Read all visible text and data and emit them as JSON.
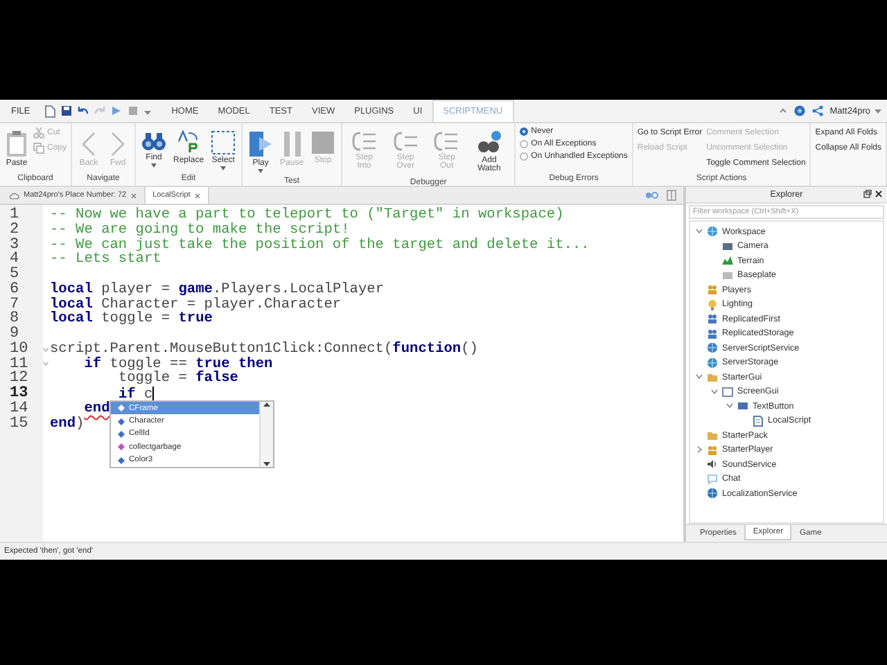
{
  "menu_bar": {
    "file": "FILE",
    "tabs": [
      {
        "label": "HOME",
        "selected": false
      },
      {
        "label": "MODEL",
        "selected": false
      },
      {
        "label": "TEST",
        "selected": false
      },
      {
        "label": "VIEW",
        "selected": false
      },
      {
        "label": "PLUGINS",
        "selected": false
      },
      {
        "label": "UI",
        "selected": false
      },
      {
        "label": "SCRIPTMENU",
        "selected": true
      }
    ],
    "user": "Matt24pro"
  },
  "ribbon": {
    "groups": [
      {
        "label": "Clipboard",
        "columns": [
          [
            {
              "kind": "large",
              "label": "Paste",
              "disabled": false
            }
          ],
          [
            {
              "kind": "small",
              "label": "Cut",
              "disabled": true
            },
            {
              "kind": "small",
              "label": "Copy",
              "disabled": true
            }
          ]
        ]
      },
      {
        "label": "Navigate",
        "columns": [
          [
            {
              "kind": "large",
              "label": "Back",
              "disabled": true
            }
          ],
          [
            {
              "kind": "large",
              "label": "Fwd",
              "disabled": true
            }
          ]
        ]
      },
      {
        "label": "Edit",
        "columns": [
          [
            {
              "kind": "large",
              "label": "Find",
              "disabled": false,
              "dropdown": true
            }
          ],
          [
            {
              "kind": "large",
              "label": "Replace",
              "disabled": false
            }
          ],
          [
            {
              "kind": "large",
              "label": "Select",
              "disabled": false,
              "dropdown": true
            }
          ]
        ]
      },
      {
        "label": "Test",
        "columns": [
          [
            {
              "kind": "large",
              "label": "Play",
              "disabled": false,
              "dropdown": true
            }
          ],
          [
            {
              "kind": "large",
              "label": "Pause",
              "disabled": true
            }
          ],
          [
            {
              "kind": "large",
              "label": "Stop",
              "disabled": true
            }
          ]
        ]
      },
      {
        "label": "Debugger",
        "columns": [
          [
            {
              "kind": "large",
              "label": "Step Into",
              "disabled": true
            }
          ],
          [
            {
              "kind": "large",
              "label": "Step Over",
              "disabled": true
            }
          ],
          [
            {
              "kind": "large",
              "label": "Step Out",
              "disabled": true
            }
          ],
          [
            {
              "kind": "large",
              "label": "Add Watch",
              "disabled": false
            }
          ]
        ]
      },
      {
        "label": "Debug Errors",
        "columns": [
          [
            {
              "kind": "radio",
              "label": "Never",
              "selected": true
            },
            {
              "kind": "radio",
              "label": "On All Exceptions",
              "selected": false
            },
            {
              "kind": "radio",
              "label": "On Unhandled Exceptions",
              "selected": false
            }
          ]
        ]
      },
      {
        "label": "Script Actions",
        "columns": [
          [
            {
              "kind": "link",
              "label": "Go to Script Error",
              "disabled": false
            },
            {
              "kind": "link",
              "label": "Reload Script",
              "disabled": true
            }
          ],
          [
            {
              "kind": "link",
              "label": "Comment Selection",
              "disabled": true
            },
            {
              "kind": "link",
              "label": "Uncomment Selection",
              "disabled": true
            },
            {
              "kind": "link",
              "label": "Toggle Comment Selection",
              "disabled": false
            }
          ]
        ]
      },
      {
        "columns": [
          [
            {
              "kind": "link",
              "label": "Expand All Folds",
              "disabled": false
            },
            {
              "kind": "link",
              "label": "Collapse All Folds",
              "disabled": false
            }
          ]
        ]
      }
    ]
  },
  "document_tabs": [
    {
      "label": "Matt24pro's Place Number: 72",
      "selected": false
    },
    {
      "label": "LocalScript",
      "selected": true
    }
  ],
  "editor": {
    "lines": [
      {
        "number": "1",
        "tokens": [
          {
            "kind": "comment",
            "text": "-- Now we have a part to teleport to (\"Target\" in workspace)"
          }
        ]
      },
      {
        "number": "2",
        "tokens": [
          {
            "kind": "comment",
            "text": "-- We are going to make the script!"
          }
        ]
      },
      {
        "number": "3",
        "tokens": [
          {
            "kind": "comment",
            "text": "-- We can just take the position of the target and delete it..."
          }
        ]
      },
      {
        "number": "4",
        "tokens": [
          {
            "kind": "comment",
            "text": "-- Lets start"
          }
        ]
      },
      {
        "number": "5"
      },
      {
        "number": "6",
        "tokens": [
          {
            "kind": "keyword",
            "text": "local"
          },
          {
            "kind": "text",
            "text": " player = "
          },
          {
            "kind": "keyword",
            "text": "game"
          },
          {
            "kind": "text",
            "text": ".Players.LocalPlayer"
          }
        ]
      },
      {
        "number": "7",
        "tokens": [
          {
            "kind": "keyword",
            "text": "local"
          },
          {
            "kind": "text",
            "text": " Character = player.Character"
          }
        ]
      },
      {
        "number": "8",
        "tokens": [
          {
            "kind": "keyword",
            "text": "local"
          },
          {
            "kind": "text",
            "text": " toggle = "
          },
          {
            "kind": "keyword",
            "text": "true"
          }
        ]
      },
      {
        "number": "9"
      },
      {
        "number": "10",
        "fold": true,
        "tokens": [
          {
            "kind": "text",
            "text": "script.Parent.MouseButton1Click:Connect("
          },
          {
            "kind": "keyword",
            "text": "function"
          },
          {
            "kind": "text",
            "text": "()"
          }
        ]
      },
      {
        "number": "11",
        "fold": true,
        "tokens": [
          {
            "kind": "keyword",
            "text": "    if"
          },
          {
            "kind": "text",
            "text": " toggle == "
          },
          {
            "kind": "keyword",
            "text": "true"
          },
          {
            "kind": "keyword",
            "text": " then"
          }
        ]
      },
      {
        "number": "12",
        "tokens": [
          {
            "kind": "text",
            "text": "        toggle = "
          },
          {
            "kind": "keyword",
            "text": "false"
          }
        ]
      },
      {
        "number": "13",
        "current": true,
        "tokens": [
          {
            "kind": "keyword",
            "text": "        if"
          },
          {
            "kind": "text",
            "text": " c"
          }
        ]
      },
      {
        "number": "14",
        "tokens": [
          {
            "kind": "error",
            "text": "    end"
          }
        ]
      },
      {
        "number": "15",
        "tokens": [
          {
            "kind": "keyword",
            "text": "end"
          },
          {
            "kind": "text",
            "text": ")"
          }
        ]
      }
    ],
    "autocomplete": [
      {
        "label": "CFrame",
        "kind": "property",
        "selected": true
      },
      {
        "label": "Character",
        "kind": "property",
        "selected": false
      },
      {
        "label": "CellId",
        "kind": "property",
        "selected": false
      },
      {
        "label": "collectgarbage",
        "kind": "function",
        "selected": false
      },
      {
        "label": "Color3",
        "kind": "property",
        "selected": false
      }
    ]
  },
  "explorer": {
    "title": "Explorer",
    "filter": {
      "placeholder": "Filter workspace (Ctrl+Shift+X)"
    },
    "tree": [
      {
        "label": "Workspace",
        "expanded": true,
        "children": [
          {
            "label": "Camera"
          },
          {
            "label": "Terrain"
          },
          {
            "label": "Baseplate"
          }
        ]
      },
      {
        "label": "Players"
      },
      {
        "label": "Lighting"
      },
      {
        "label": "ReplicatedFirst"
      },
      {
        "label": "ReplicatedStorage"
      },
      {
        "label": "ServerScriptService"
      },
      {
        "label": "ServerStorage"
      },
      {
        "label": "StarterGui",
        "expanded": true,
        "children": [
          {
            "label": "ScreenGui",
            "expanded": true,
            "children": [
              {
                "label": "TextButton",
                "expanded": true,
                "children": [
                  {
                    "label": "LocalScript"
                  }
                ]
              }
            ]
          }
        ]
      },
      {
        "label": "StarterPack"
      },
      {
        "label": "StarterPlayer",
        "expanded": false
      },
      {
        "label": "SoundService"
      },
      {
        "label": "Chat"
      },
      {
        "label": "LocalizationService"
      }
    ],
    "tabs": [
      {
        "label": "Properties",
        "selected": false
      },
      {
        "label": "Explorer",
        "selected": true
      },
      {
        "label": "Game",
        "selected": false
      }
    ]
  },
  "status_bar": "Expected 'then', got 'end'"
}
